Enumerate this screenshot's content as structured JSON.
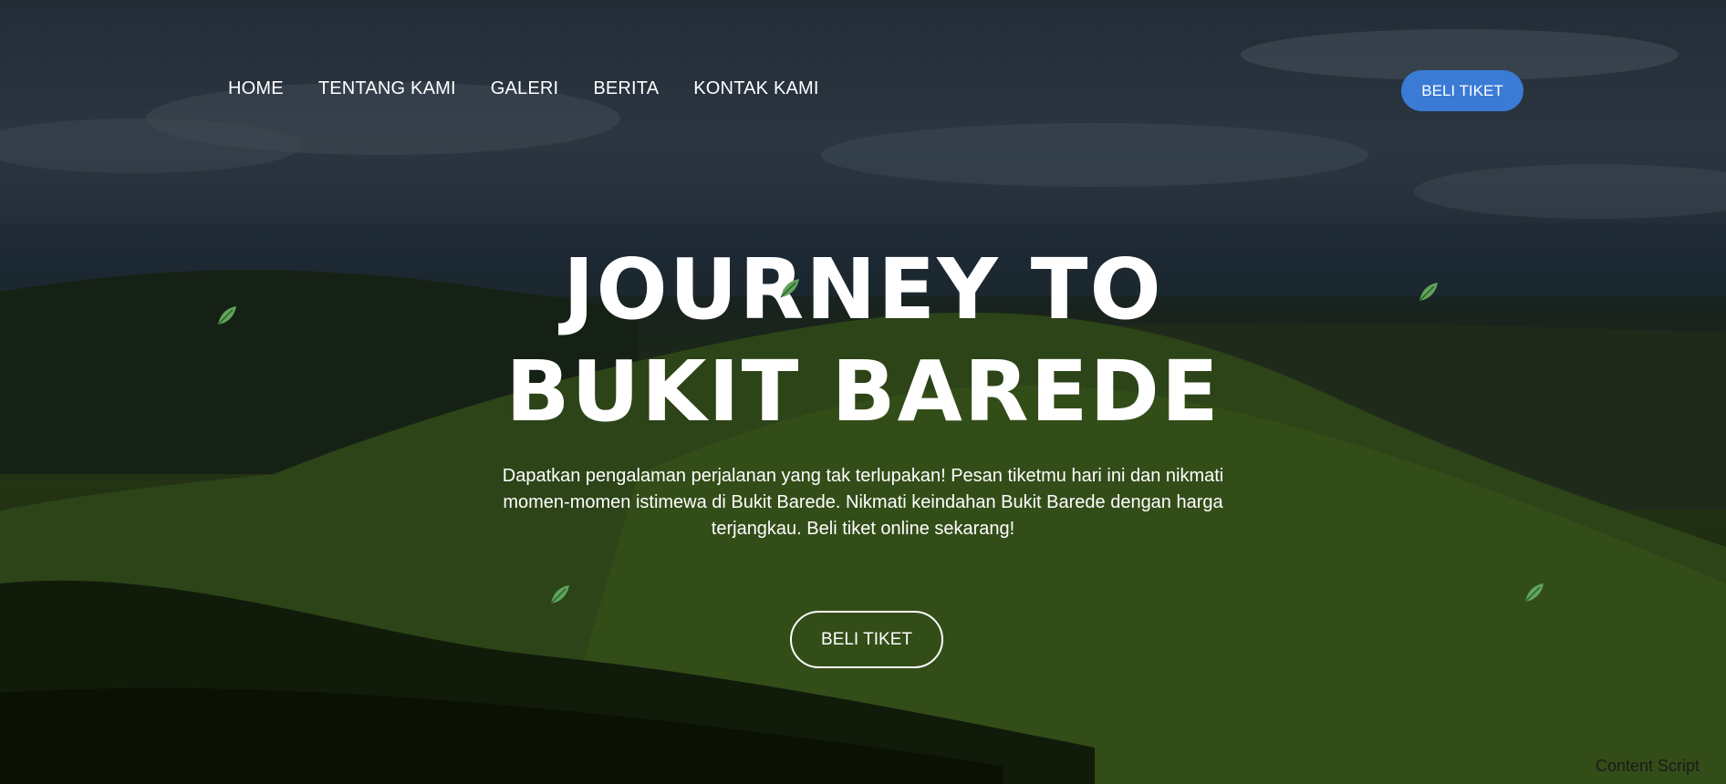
{
  "nav": {
    "links": [
      {
        "label": "HOME"
      },
      {
        "label": "TENTANG KAMI"
      },
      {
        "label": "GALERI"
      },
      {
        "label": "BERITA"
      },
      {
        "label": "KONTAK KAMI"
      }
    ],
    "cta_label": "BELI TIKET"
  },
  "hero": {
    "title_line1": "JOURNEY TO",
    "title_line2": "BUKIT BAREDE",
    "description": "Dapatkan pengalaman perjalanan yang tak terlupakan! Pesan tiketmu hari ini dan nikmati momen-momen istimewa di Bukit Barede. Nikmati keindahan Bukit Barede dengan harga terjangkau. Beli tiket online sekarang!",
    "cta_label": "BELI TIKET"
  },
  "decorations": {
    "leaf_icon": "leaf-icon",
    "leaf_color": "#5fa55a"
  },
  "colors": {
    "accent": "#3a7bd5",
    "text": "#ffffff"
  },
  "overlay_label": "Content Script"
}
